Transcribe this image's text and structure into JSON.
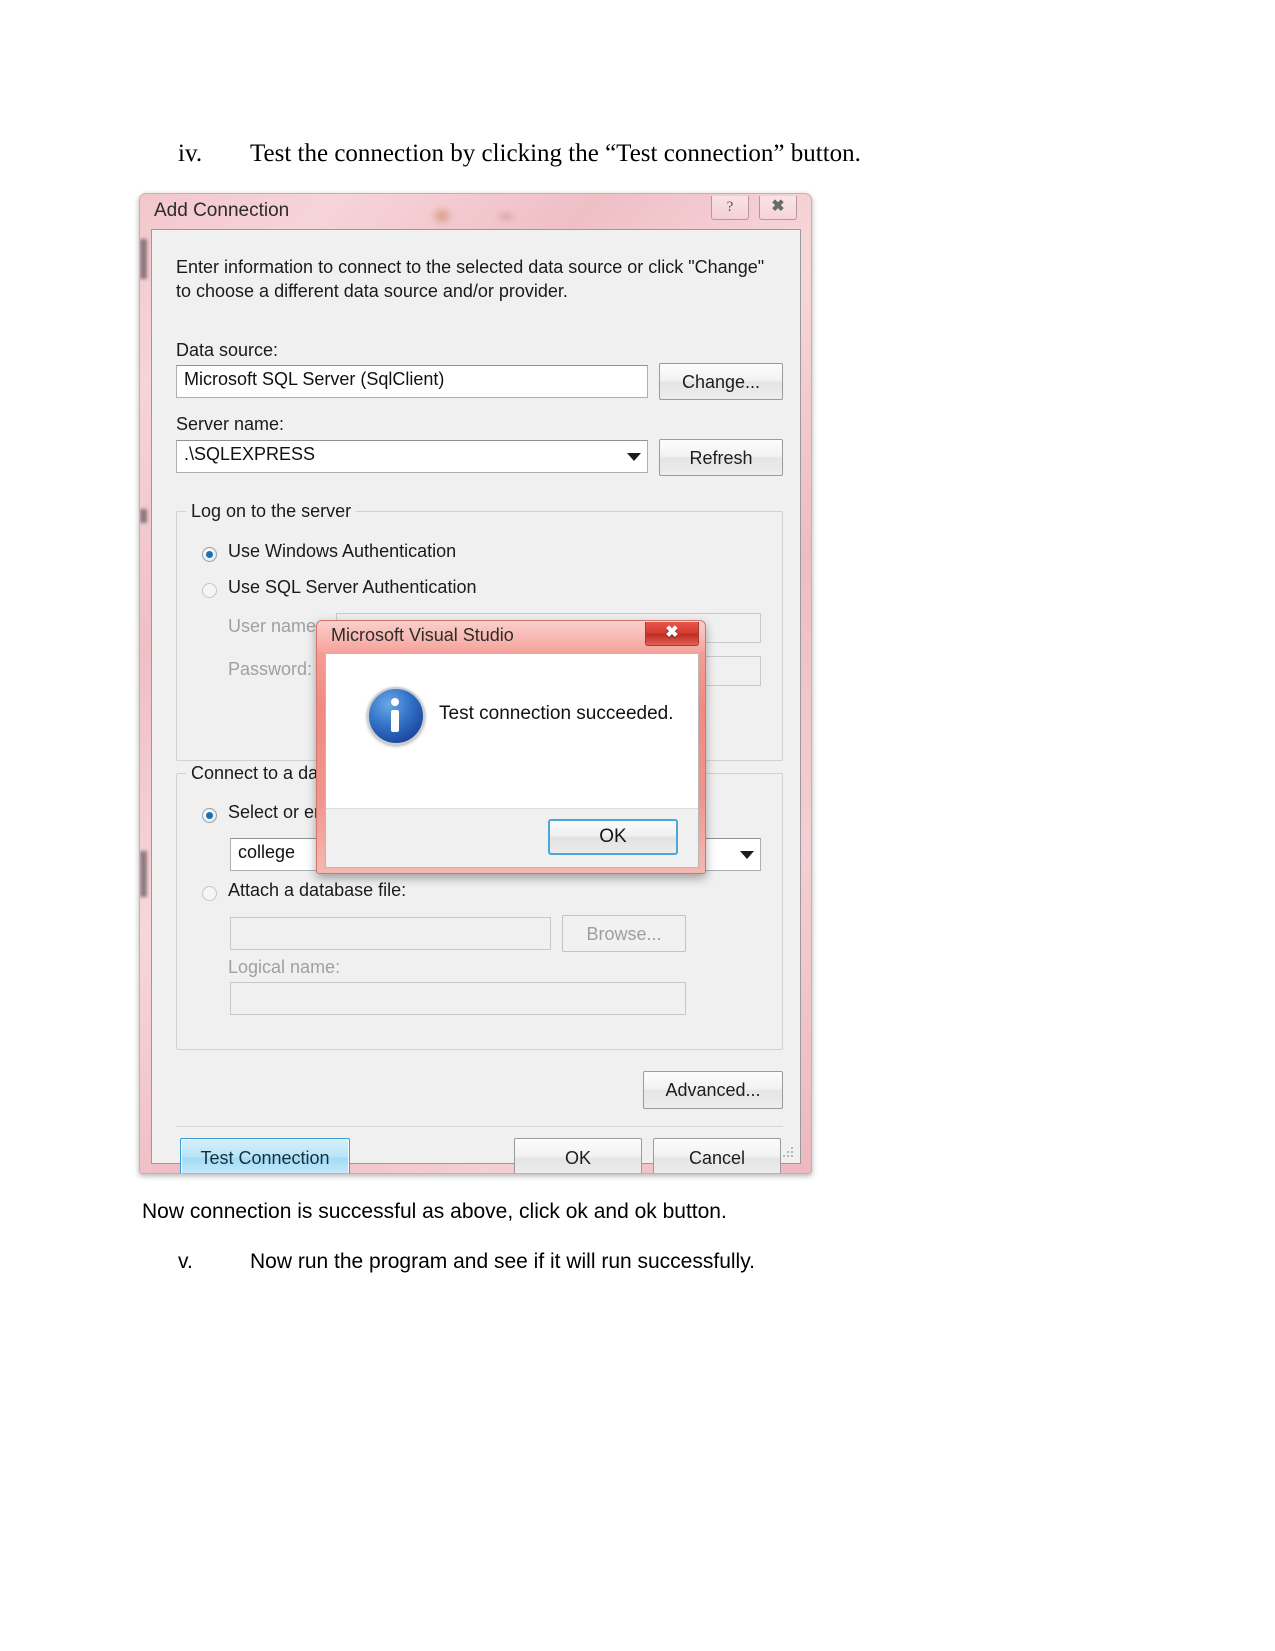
{
  "document": {
    "step_iv": {
      "number": "iv.",
      "text": "Test the connection by clicking the “Test connection” button."
    },
    "caption": "Now connection is successful as above, click ok and ok button.",
    "step_v": {
      "number": "v.",
      "text": "Now run the program and see if it will run successfully."
    }
  },
  "add_connection_dialog": {
    "title": "Add Connection",
    "help_button": "?",
    "close_button": "✖",
    "instruction": "Enter information to connect to the selected data source or click \"Change\" to choose a different data source and/or provider.",
    "data_source": {
      "label": "Data source:",
      "value": "Microsoft SQL Server (SqlClient)",
      "change_button": "Change..."
    },
    "server_name": {
      "label": "Server name:",
      "value": ".\\SQLEXPRESS",
      "refresh_button": "Refresh"
    },
    "logon_group": {
      "title": "Log on to the server",
      "windows_auth": {
        "label": "Use Windows Authentication",
        "checked": true
      },
      "sql_auth": {
        "label": "Use SQL Server Authentication",
        "checked": false
      },
      "user_name": {
        "label": "User name:",
        "value": ""
      },
      "password": {
        "label": "Password:",
        "value": ""
      }
    },
    "database_group": {
      "title": "Connect to a database",
      "select_db": {
        "label": "Select or enter a database name:",
        "checked": true,
        "value": "college"
      },
      "attach_db": {
        "label": "Attach a database file:",
        "checked": false,
        "value": ""
      },
      "browse_button": "Browse...",
      "logical_name": {
        "label": "Logical name:",
        "value": ""
      }
    },
    "advanced_button": "Advanced...",
    "test_connection_button": "Test Connection",
    "ok_button": "OK",
    "cancel_button": "Cancel"
  },
  "message_box": {
    "title": "Microsoft Visual Studio",
    "close_button": "✖",
    "message": "Test connection succeeded.",
    "ok_button": "OK",
    "icon": "information-icon"
  },
  "colors": {
    "aero_frame_pink": "#f2c7cc",
    "messagebox_frame_red": "#ef958d",
    "dialog_face": "#f0f0f0",
    "focus_blue": "#4aa7d8",
    "info_icon_blue": "#2f6fc4"
  }
}
